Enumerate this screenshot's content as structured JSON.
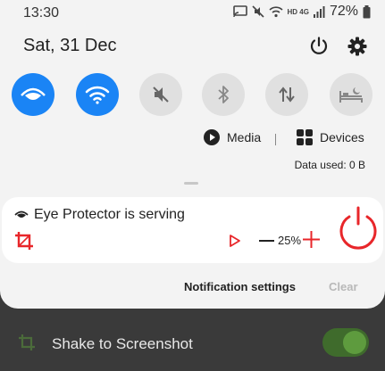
{
  "status_bar": {
    "time": "13:30",
    "network_label": "HD 4G",
    "battery_percent": "72%"
  },
  "header": {
    "date": "Sat, 31 Dec"
  },
  "quick_settings": [
    {
      "name": "eye-protector",
      "icon": "eye-icon",
      "active": true
    },
    {
      "name": "wifi",
      "icon": "wifi-icon",
      "active": true
    },
    {
      "name": "sound",
      "icon": "mute-icon",
      "active": false
    },
    {
      "name": "bluetooth",
      "icon": "bluetooth-icon",
      "active": false
    },
    {
      "name": "mobile-data",
      "icon": "data-arrows-icon",
      "active": false
    },
    {
      "name": "sleep",
      "icon": "bed-icon",
      "active": false
    }
  ],
  "media": {
    "media_label": "Media",
    "devices_label": "Devices",
    "data_used": "Data used: 0 B"
  },
  "notification": {
    "title": "Eye Protector is serving",
    "percent": "25%",
    "accent_color": "#e8262a"
  },
  "footer": {
    "settings_label": "Notification settings",
    "clear_label": "Clear"
  },
  "background_app": {
    "label": "Shake to Screenshot",
    "toggle_on": true
  },
  "colors": {
    "accent_blue": "#1a84f5",
    "red": "#e8262a",
    "green_toggle": "#5e9b3e"
  }
}
